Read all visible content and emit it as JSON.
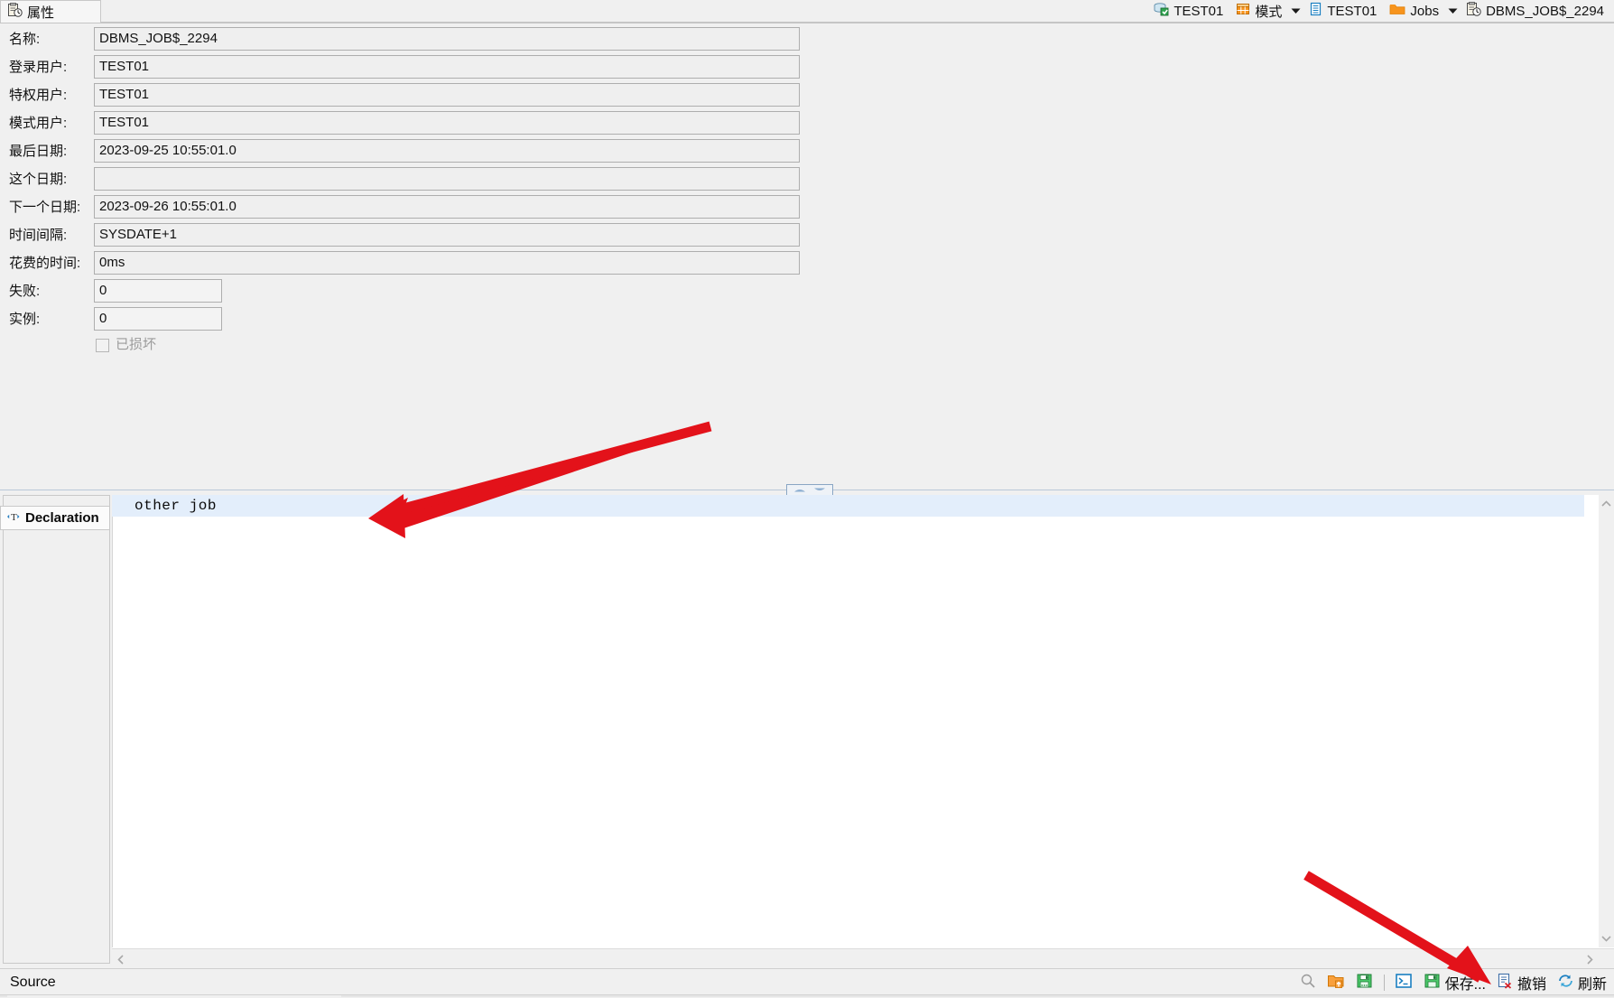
{
  "window": {
    "tab": {
      "label": "属性",
      "icon": "properties-clock-icon"
    }
  },
  "breadcrumb": [
    {
      "label": "TEST01",
      "icon": "database-connection-icon",
      "caret": false
    },
    {
      "label": "模式",
      "icon": "schema-grid-icon",
      "caret": true
    },
    {
      "label": "TEST01",
      "icon": "schema-document-icon",
      "caret": false
    },
    {
      "label": "Jobs",
      "icon": "folder-icon",
      "caret": true
    },
    {
      "label": "DBMS_JOB$_2294",
      "icon": "job-clock-icon",
      "caret": false
    }
  ],
  "properties": {
    "fields": [
      {
        "label": "名称:",
        "value": "DBMS_JOB$_2294",
        "size": "wide"
      },
      {
        "label": "登录用户:",
        "value": "TEST01",
        "size": "wide"
      },
      {
        "label": "特权用户:",
        "value": "TEST01",
        "size": "wide"
      },
      {
        "label": "模式用户:",
        "value": "TEST01",
        "size": "wide"
      },
      {
        "label": "最后日期:",
        "value": "2023-09-25 10:55:01.0",
        "size": "wide"
      },
      {
        "label": "这个日期:",
        "value": "",
        "size": "wide"
      },
      {
        "label": "下一个日期:",
        "value": "2023-09-26 10:55:01.0",
        "size": "wide"
      },
      {
        "label": "时间间隔:",
        "value": "SYSDATE+1",
        "size": "wide"
      },
      {
        "label": "花费的时间:",
        "value": "0ms",
        "size": "wide"
      },
      {
        "label": "失败:",
        "value": "0",
        "size": "narrow"
      },
      {
        "label": "实例:",
        "value": "0",
        "size": "narrow"
      }
    ],
    "checkbox": {
      "label": "已损坏",
      "checked": false,
      "disabled": true
    }
  },
  "outline": {
    "tab": {
      "label": "Declaration",
      "icon": "declaration-icon"
    }
  },
  "editor": {
    "content": "other job",
    "highlighted_line": 1
  },
  "statusbar": {
    "source_label": "Source",
    "tools": [
      {
        "name": "search-icon",
        "label": ""
      },
      {
        "name": "load-from-file-icon",
        "label": ""
      },
      {
        "name": "save-to-file-icon",
        "label": ""
      },
      {
        "name": "sql-console-icon",
        "label": ""
      },
      {
        "name": "save-icon",
        "label": "保存..."
      },
      {
        "name": "undo-icon",
        "label": "撤销"
      },
      {
        "name": "refresh-icon",
        "label": "刷新"
      }
    ]
  },
  "colors": {
    "accent_orange": "#f29100",
    "accent_blue": "#1a7fc1",
    "highlight_row": "#e3eefb",
    "annotation_red": "#e3121a",
    "panel_bg": "#f0f0f0"
  }
}
